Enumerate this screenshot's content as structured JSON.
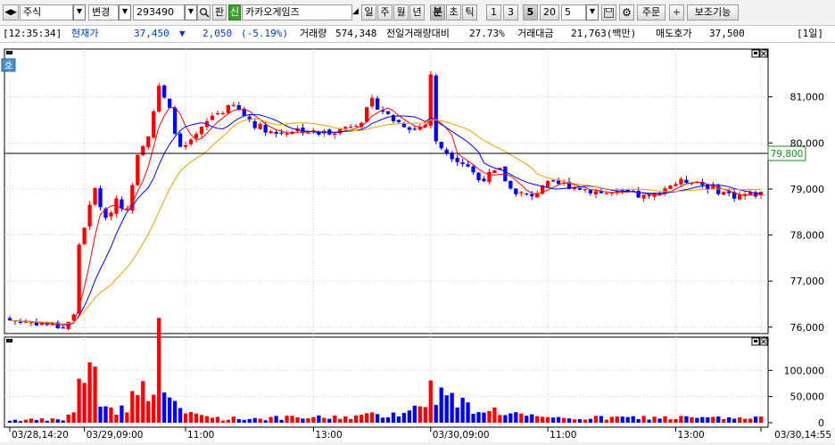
{
  "toolbar": {
    "market": "주식",
    "mode": "변경",
    "code": "293490",
    "pan_label": "판",
    "new_badge": "신",
    "stock_name": "카카오게임즈",
    "period_buttons": [
      "일",
      "주",
      "월",
      "년",
      "분",
      "초",
      "틱"
    ],
    "active_period": "분",
    "interval_buttons": [
      "1",
      "3",
      "5",
      "20"
    ],
    "active_interval": "5",
    "interval_value": "5",
    "order_label": "주문",
    "plus_label": "+",
    "assist_label": "보조기능"
  },
  "quote": {
    "time": "[12:35:34]",
    "price_label": "현재가",
    "price": "37,450",
    "change_symbol": "▼",
    "change": "2,050",
    "change_pct": "(-5.19%)",
    "volume_label": "거래량",
    "volume": "574,348",
    "vol_ratio_label": "전일거래량대비",
    "vol_ratio": "27.73%",
    "amount_label": "거래대금",
    "amount": "21,763(백만)",
    "ask_label": "매도호가",
    "ask": "37,500",
    "period_tag": "[1일]"
  },
  "chart_labels": {
    "corner_tag": "호",
    "current_price_label": "79,800"
  },
  "colors": {
    "up": "#ff0000",
    "down": "#0000ff",
    "ma_short": "#ff0000",
    "ma_mid": "#0000ff",
    "ma_long": "#e8a000"
  },
  "chart_data": {
    "type": "candlestick",
    "price_axis": {
      "ticks": [
        76000,
        77000,
        78000,
        79000,
        80000,
        81000
      ],
      "tick_labels": [
        "76,000",
        "77,000",
        "78,000",
        "79,000",
        "80,000",
        "81,000"
      ],
      "range": [
        75900,
        82000
      ]
    },
    "volume_axis": {
      "ticks": [
        0,
        50000,
        100000
      ],
      "tick_labels": [
        "0",
        "50,000",
        "100,000"
      ],
      "range": [
        0,
        150000
      ]
    },
    "x_labels": [
      {
        "index": 0,
        "label": "03/28,14:20"
      },
      {
        "index": 14,
        "label": "03/29,09:00"
      },
      {
        "index": 33,
        "label": "11:00"
      },
      {
        "index": 57,
        "label": "13:00"
      },
      {
        "index": 79,
        "label": "03/30,09:00"
      },
      {
        "index": 101,
        "label": "11:00"
      },
      {
        "index": 125,
        "label": "13:00"
      },
      {
        "index": 141,
        "label": "03/30,14:55"
      }
    ],
    "current_price": 79800,
    "num_candles": 142,
    "close_keypoints": [
      [
        0,
        76150
      ],
      [
        5,
        76100
      ],
      [
        10,
        76000
      ],
      [
        12,
        76250
      ],
      [
        13,
        77800
      ],
      [
        16,
        79000
      ],
      [
        18,
        78300
      ],
      [
        20,
        78800
      ],
      [
        22,
        78500
      ],
      [
        24,
        79800
      ],
      [
        26,
        80200
      ],
      [
        28,
        81200
      ],
      [
        30,
        80700
      ],
      [
        32,
        79850
      ],
      [
        34,
        80000
      ],
      [
        38,
        80600
      ],
      [
        42,
        80800
      ],
      [
        46,
        80400
      ],
      [
        50,
        80200
      ],
      [
        54,
        80300
      ],
      [
        58,
        80200
      ],
      [
        62,
        80300
      ],
      [
        66,
        80500
      ],
      [
        68,
        80900
      ],
      [
        72,
        80500
      ],
      [
        76,
        80300
      ],
      [
        78,
        80400
      ],
      [
        79,
        81500
      ],
      [
        80,
        80000
      ],
      [
        82,
        79800
      ],
      [
        86,
        79500
      ],
      [
        88,
        79200
      ],
      [
        90,
        79300
      ],
      [
        92,
        79400
      ],
      [
        94,
        79000
      ],
      [
        96,
        78900
      ],
      [
        98,
        78800
      ],
      [
        100,
        79100
      ],
      [
        104,
        79100
      ],
      [
        108,
        79000
      ],
      [
        112,
        78900
      ],
      [
        116,
        78900
      ],
      [
        120,
        78800
      ],
      [
        124,
        79100
      ],
      [
        128,
        79200
      ],
      [
        132,
        79000
      ],
      [
        136,
        78850
      ],
      [
        141,
        78900
      ]
    ],
    "volume_keypoints": [
      [
        0,
        5000
      ],
      [
        10,
        6000
      ],
      [
        12,
        20000
      ],
      [
        13,
        110000
      ],
      [
        14,
        60000
      ],
      [
        16,
        125000
      ],
      [
        17,
        40000
      ],
      [
        20,
        20000
      ],
      [
        26,
        70000
      ],
      [
        28,
        140000
      ],
      [
        30,
        60000
      ],
      [
        32,
        20000
      ],
      [
        40,
        8000
      ],
      [
        60,
        10000
      ],
      [
        70,
        15000
      ],
      [
        78,
        30000
      ],
      [
        79,
        115000
      ],
      [
        80,
        60000
      ],
      [
        82,
        50000
      ],
      [
        86,
        30000
      ],
      [
        90,
        25000
      ],
      [
        96,
        15000
      ],
      [
        100,
        8000
      ],
      [
        120,
        10000
      ],
      [
        141,
        8000
      ]
    ],
    "series": [
      {
        "name": "",
        "kind": "ma",
        "period": 5
      },
      {
        "name": "",
        "kind": "ma",
        "period": 10
      },
      {
        "name": "",
        "kind": "ma",
        "period": 20
      }
    ]
  }
}
